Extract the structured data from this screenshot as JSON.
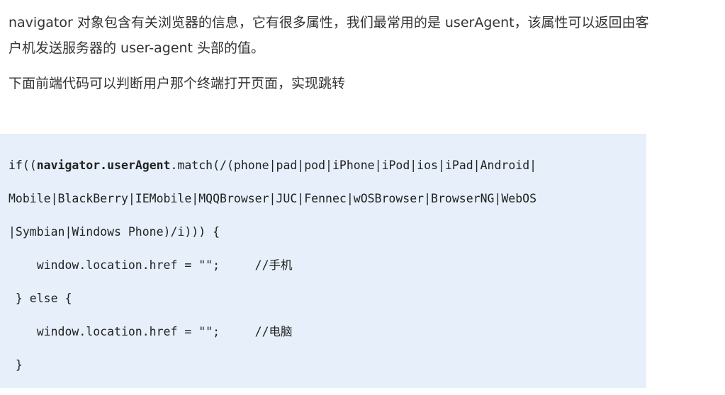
{
  "intro": {
    "line1": "navigator 对象包含有关浏览器的信息，它有很多属性，我们最常用的是 userAgent，该属性可以返回由客",
    "line2": "户机发送服务器的 user-agent 头部的值。",
    "line3": "下面前端代码可以判断用户那个终端打开页面，实现跳转"
  },
  "code": {
    "l1_pre": "if((",
    "l1_bold": "navigator.userAgent",
    "l1_post": ".match(/(phone|pad|pod|iPhone|iPod|ios|iPad|Android|",
    "l2": "Mobile|BlackBerry|IEMobile|MQQBrowser|JUC|Fennec|wOSBrowser|BrowserNG|WebOS",
    "l3": "|Symbian|Windows Phone)/i))) {",
    "l4": "    window.location.href = \"\";     //手机",
    "l5": " } else {",
    "l6": "    window.location.href = \"\";     //电脑",
    "l7": " }"
  }
}
